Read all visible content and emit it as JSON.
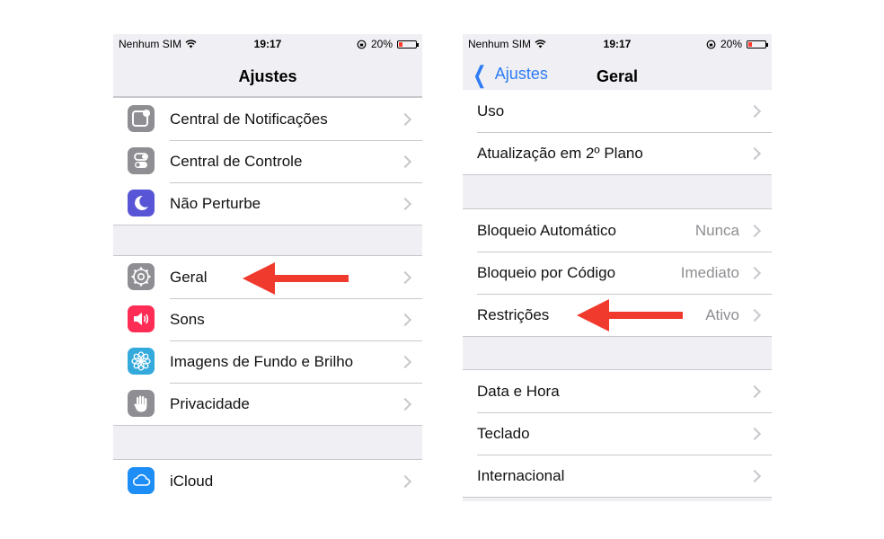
{
  "status_bar": {
    "carrier": "Nenhum SIM",
    "time": "19:17",
    "battery": "20%",
    "battery_level": 0.2
  },
  "left_screen": {
    "title": "Ajustes",
    "groups": [
      {
        "items": [
          {
            "label": "Central de Notificações",
            "icon": "notifications-icon",
            "color": "#8e8e93"
          },
          {
            "label": "Central de Controle",
            "icon": "control-center-icon",
            "color": "#8e8e93"
          },
          {
            "label": "Não Perturbe",
            "icon": "moon-icon",
            "color": "#5856d6"
          }
        ]
      },
      {
        "items": [
          {
            "label": "Geral",
            "icon": "gear-icon",
            "color": "#8e8e93"
          },
          {
            "label": "Sons",
            "icon": "speaker-icon",
            "color": "#ff2d55"
          },
          {
            "label": "Imagens de Fundo e Brilho",
            "icon": "wallpaper-flower-icon",
            "color": "#34aadc"
          },
          {
            "label": "Privacidade",
            "icon": "hand-icon",
            "color": "#8e8e93"
          }
        ]
      },
      {
        "items": [
          {
            "label": "iCloud",
            "icon": "icloud-icon",
            "color": "#1d8ef5"
          }
        ]
      }
    ]
  },
  "right_screen": {
    "back_label": "Ajustes",
    "title": "Geral",
    "groups": [
      {
        "items": [
          {
            "label": "Uso",
            "value": ""
          },
          {
            "label": "Atualização em 2º Plano",
            "value": ""
          }
        ]
      },
      {
        "items": [
          {
            "label": "Bloqueio Automático",
            "value": "Nunca"
          },
          {
            "label": "Bloqueio por Código",
            "value": "Imediato"
          },
          {
            "label": "Restrições",
            "value": "Ativo"
          }
        ]
      },
      {
        "items": [
          {
            "label": "Data e Hora",
            "value": ""
          },
          {
            "label": "Teclado",
            "value": ""
          },
          {
            "label": "Internacional",
            "value": ""
          }
        ]
      }
    ]
  },
  "annotations": {
    "arrow_color": "#f03a2e"
  }
}
